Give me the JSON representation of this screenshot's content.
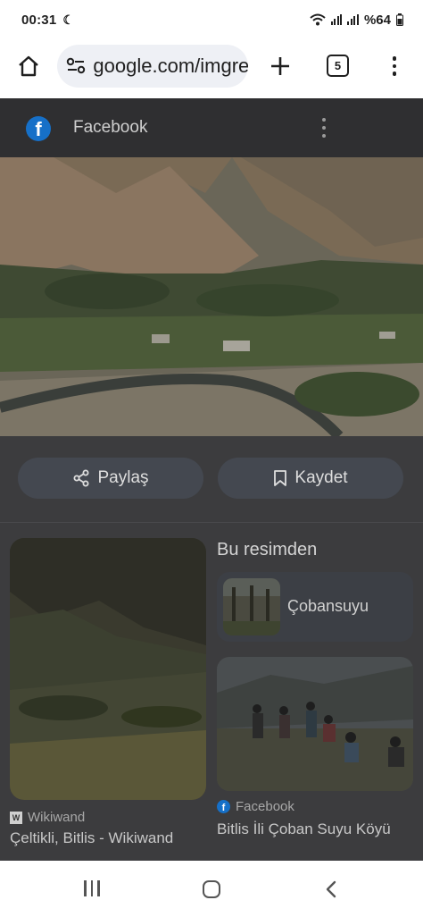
{
  "status_bar": {
    "time": "00:31",
    "battery": "%64"
  },
  "toolbar": {
    "url": "google.com/imgres",
    "tab_count": "5"
  },
  "source": {
    "name": "Facebook"
  },
  "actions": {
    "share_label": "Paylaş",
    "save_label": "Kaydet"
  },
  "left_result": {
    "source": "Wikiwand",
    "title": "Çeltikli, Bitlis - Wikiwand"
  },
  "from_image": {
    "heading": "Bu resimden",
    "entity": "Çobansuyu"
  },
  "right_result": {
    "source": "Facebook",
    "title": "Bitlis İli Çoban Suyu Köyü"
  },
  "colors": {
    "facebook_blue": "#1670c8",
    "overlay_dark": "#3c3c3e",
    "url_pill": "#eef0f5"
  }
}
